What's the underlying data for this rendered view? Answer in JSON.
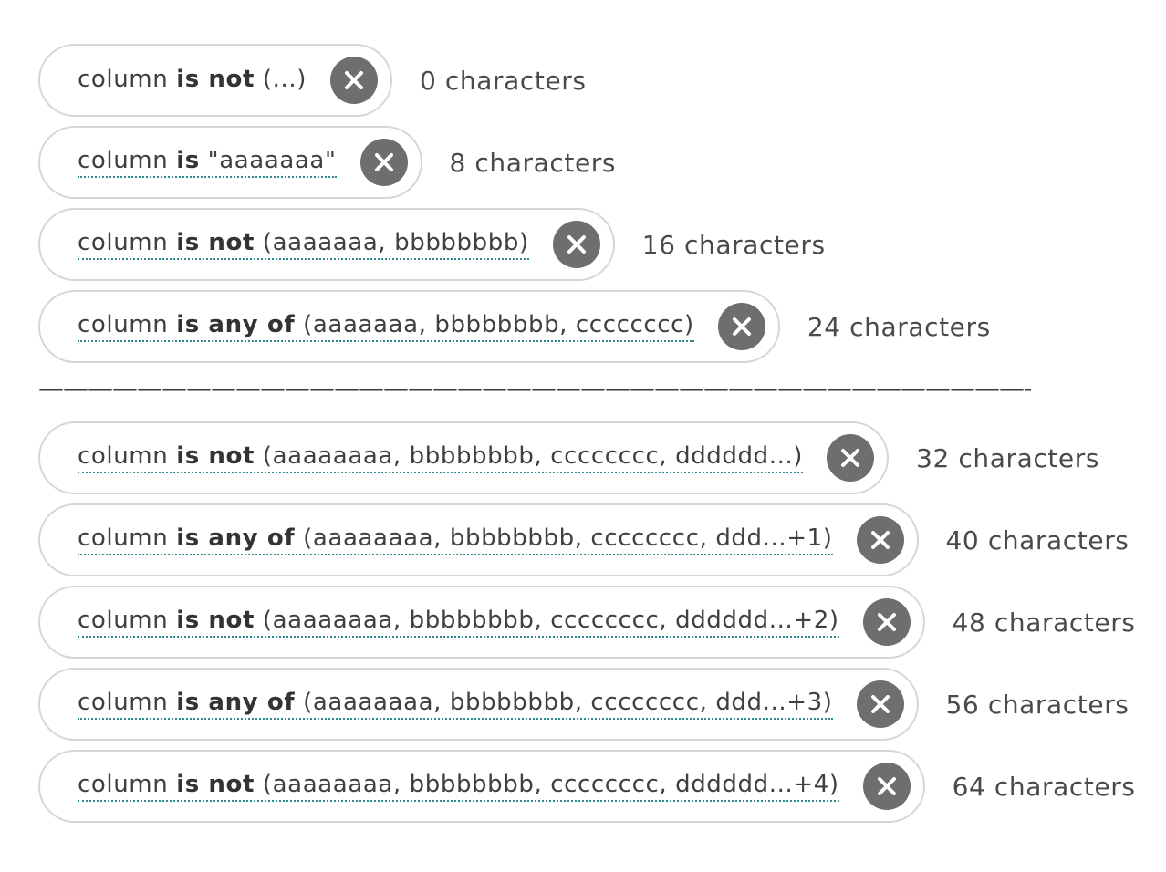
{
  "divider": "——————————————————————————————————————————",
  "filters": [
    {
      "column": "column",
      "op": "is not",
      "value": "(...)",
      "count": "0 characters",
      "underline": false
    },
    {
      "column": "column",
      "op": "is",
      "value": "\"aaaaaaa\"",
      "count": "8 characters",
      "underline": true
    },
    {
      "column": "column",
      "op": "is not",
      "value": "(aaaaaaa, bbbbbbbb)",
      "count": "16 characters",
      "underline": true
    },
    {
      "column": "column",
      "op": "is any of",
      "value": "(aaaaaaa, bbbbbbbb, cccccccc)",
      "count": "24 characters",
      "underline": true
    },
    {
      "column": "column",
      "op": "is not",
      "value": "(aaaaaaaa, bbbbbbbb, cccccccc, dddddd...)",
      "count": "32 characters",
      "underline": true
    },
    {
      "column": "column",
      "op": "is any of",
      "value": "(aaaaaaaa, bbbbbbbb, cccccccc, ddd...+1)",
      "count": "40 characters",
      "underline": true
    },
    {
      "column": "column",
      "op": "is not",
      "value": "(aaaaaaaa, bbbbbbbb, cccccccc, dddddd...+2)",
      "count": "48 characters",
      "underline": true
    },
    {
      "column": "column",
      "op": "is any of",
      "value": "(aaaaaaaa, bbbbbbbb, cccccccc, ddd...+3)",
      "count": "56 characters",
      "underline": true
    },
    {
      "column": "column",
      "op": "is not",
      "value": "(aaaaaaaa, bbbbbbbb, cccccccc, dddddd...+4)",
      "count": "64 characters",
      "underline": true
    }
  ]
}
